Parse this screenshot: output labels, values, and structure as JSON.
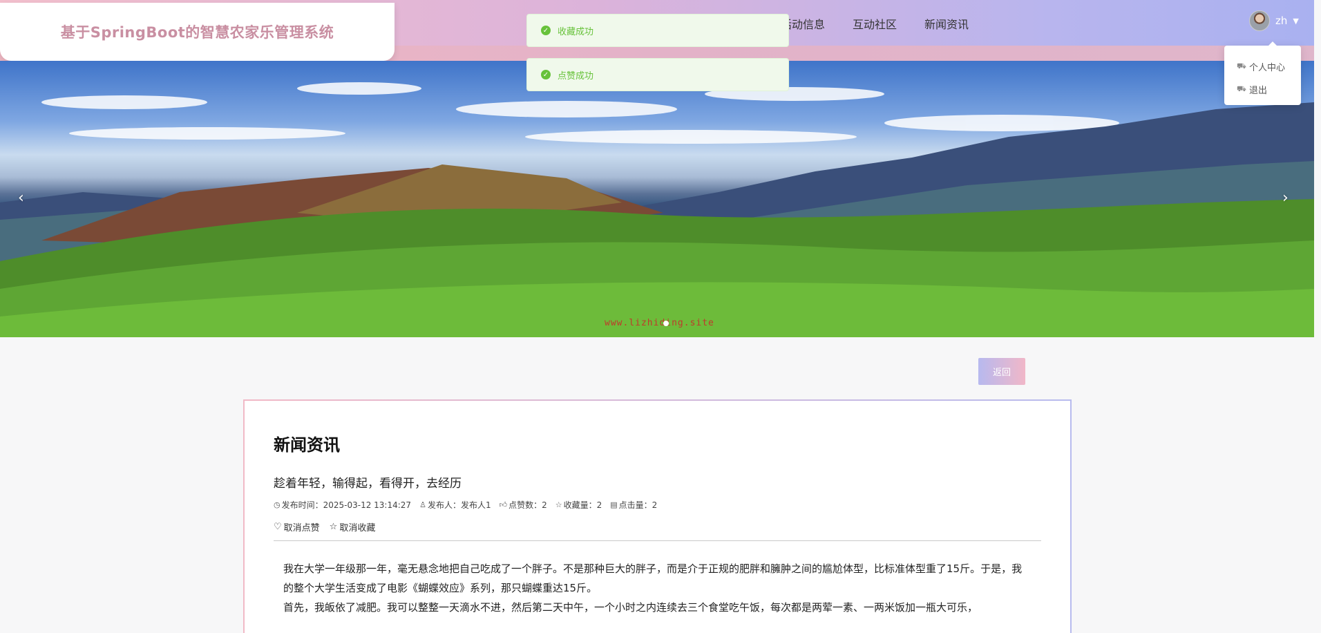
{
  "header": {
    "brand_title": "基于SpringBoot的智慧农家乐管理系统",
    "nav": [
      {
        "label": "活动信息"
      },
      {
        "label": "互动社区"
      },
      {
        "label": "新闻资讯"
      }
    ],
    "user": {
      "name": "zh"
    }
  },
  "user_menu": {
    "items": [
      {
        "label": "个人中心",
        "icon": "truck-icon"
      },
      {
        "label": "退出",
        "icon": "truck-icon"
      }
    ]
  },
  "notifications": [
    {
      "text": "收藏成功",
      "type": "success"
    },
    {
      "text": "点赞成功",
      "type": "success"
    }
  ],
  "banner": {
    "watermark": "www.lizhiding.site",
    "prev_icon": "chevron-left-icon",
    "next_icon": "chevron-right-icon"
  },
  "back_button": {
    "label": "返回"
  },
  "article": {
    "section_title": "新闻资讯",
    "title": "趁着年轻，输得起，看得开，去经历",
    "meta": {
      "publish_time": "发布时间：2025-03-12 13:14:27",
      "publisher": "发布人：发布人1",
      "likes": "点赞数：2",
      "favorites": "收藏量：2",
      "clicks": "点击量：2"
    },
    "actions": {
      "unlike": "取消点赞",
      "unfavorite": "取消收藏"
    },
    "paragraphs": [
      "我在大学一年级那一年，毫无悬念地把自己吃成了一个胖子。不是那种巨大的胖子，而是介于正规的肥胖和臃肿之间的尴尬体型，比标准体型重了15斤。于是，我的整个大学生活变成了电影《蝴蝶效应》系列，那只蝴蝶重达15斤。",
      "首先，我皈依了减肥。我可以整整一天滴水不进，然后第二天中午，一个小时之内连续去三个食堂吃午饭，每次都是两荤一素、一两米饭加一瓶大可乐，"
    ]
  },
  "colors": {
    "accent_pink": "#f1b7c8",
    "accent_lavender": "#b7b9ef",
    "brand_text": "#c98fa2",
    "success": "#67c23a"
  }
}
